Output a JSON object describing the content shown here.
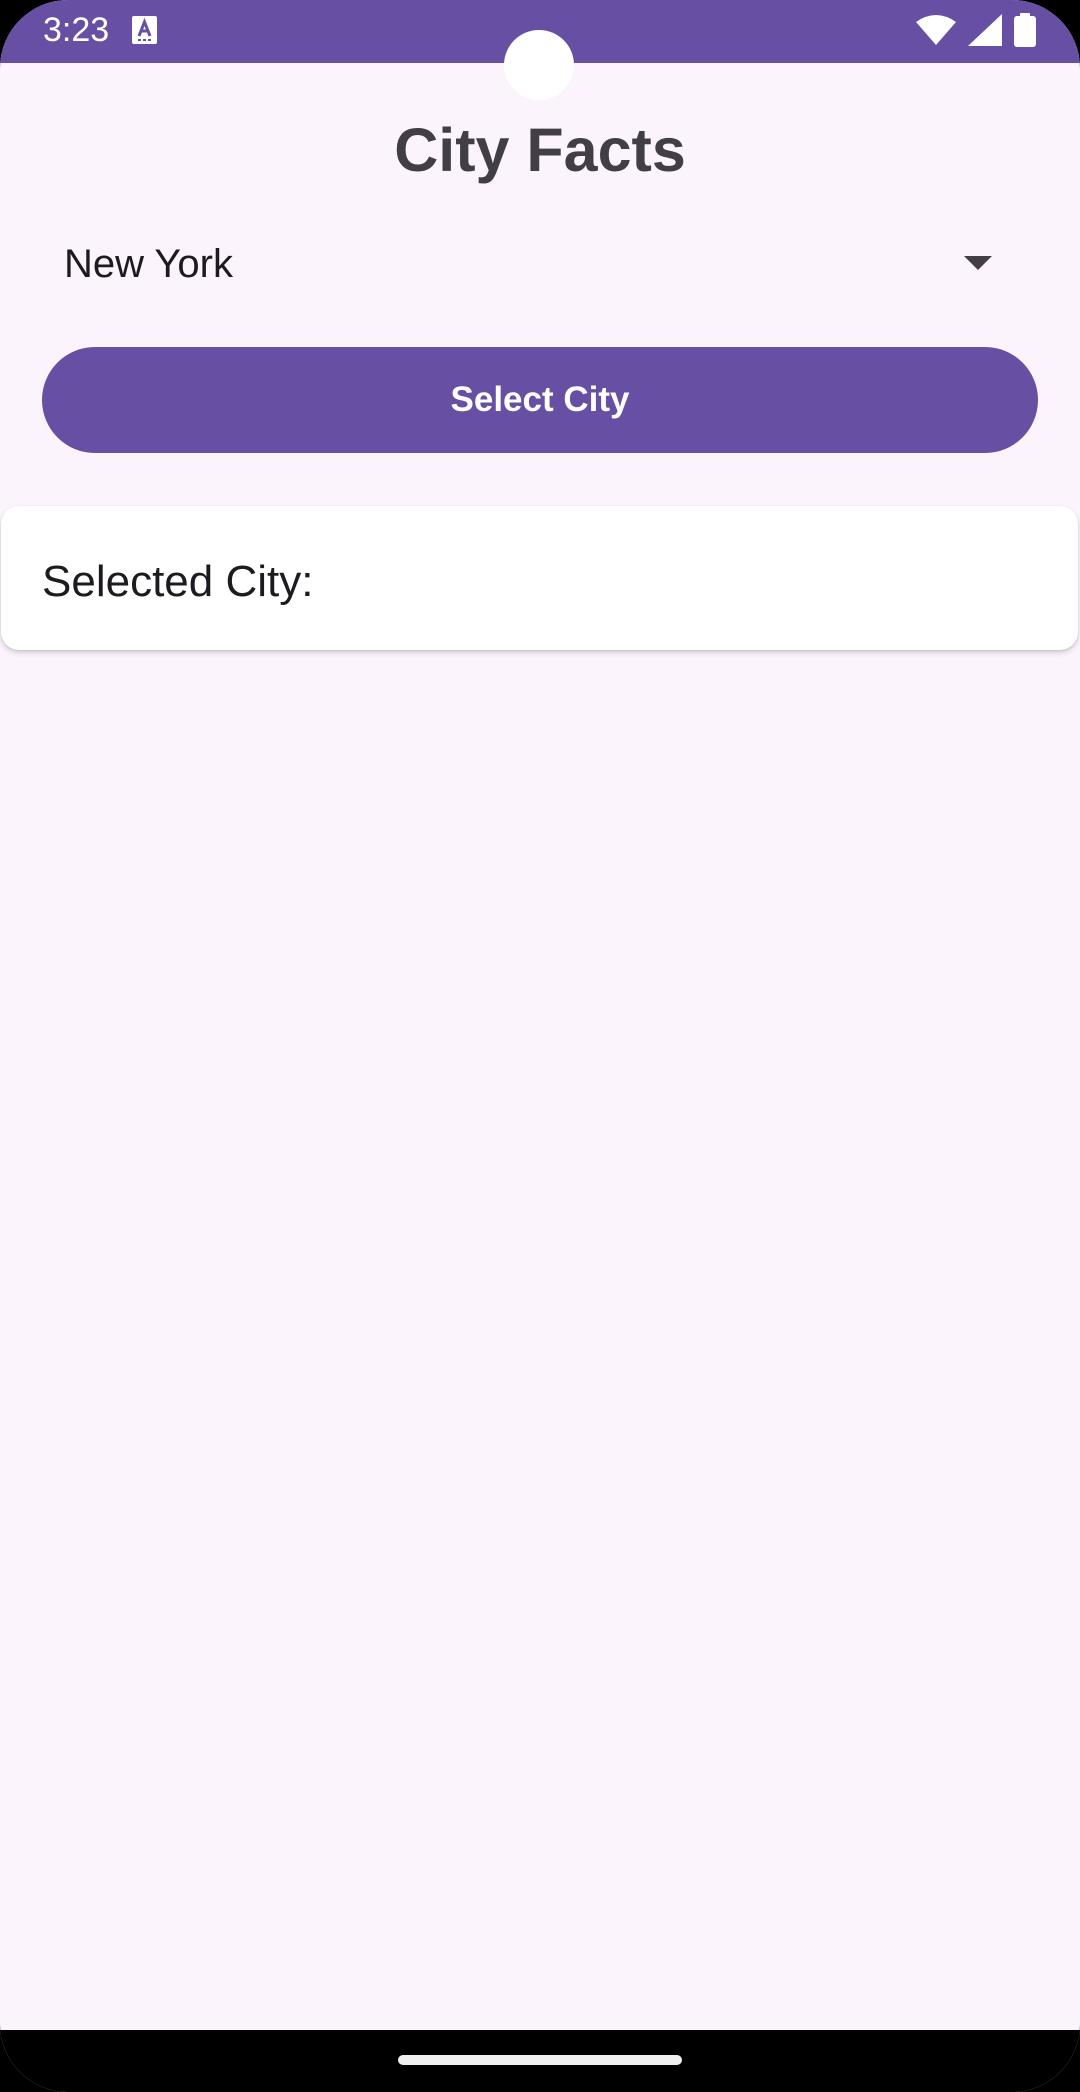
{
  "status_bar": {
    "time": "3:23",
    "notification_icon": "text-a-icon",
    "icons": [
      "wifi-icon",
      "cellular-signal-icon",
      "battery-icon"
    ],
    "background_color": "#6750a4"
  },
  "app": {
    "title": "City Facts"
  },
  "city_dropdown": {
    "selected_value": "New York",
    "icon": "dropdown-arrow-icon"
  },
  "select_button": {
    "label": "Select City",
    "color": "#6750a4"
  },
  "result_card": {
    "label": "Selected City:"
  },
  "colors": {
    "primary": "#6750a4",
    "background": "#fcf4fc",
    "title_text": "#423e46",
    "body_text": "#1d1b20"
  }
}
